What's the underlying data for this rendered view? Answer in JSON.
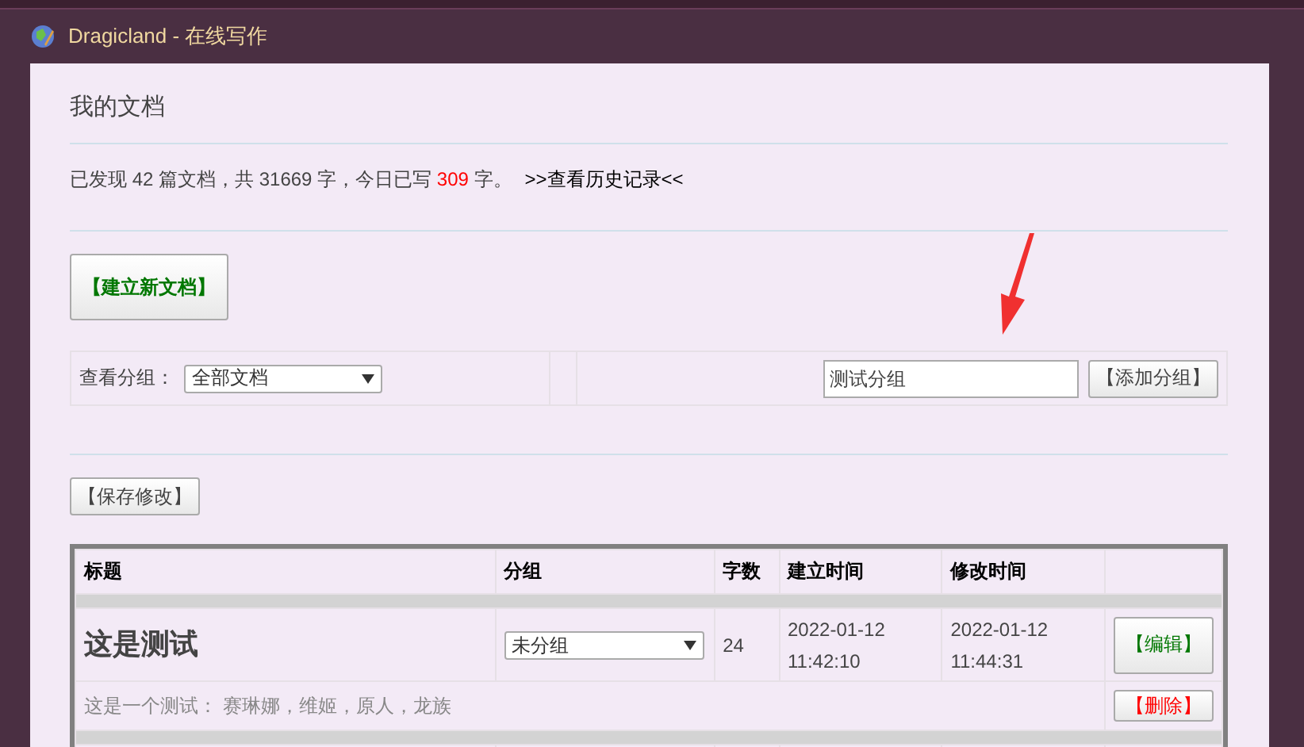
{
  "window": {
    "title": "Dragicland - 在线写作"
  },
  "heading": "我的文档",
  "stats": {
    "before": "已发现 42 篇文档，共 31669 字，今日已写 ",
    "today": "309",
    "after": " 字。",
    "link": ">>查看历史记录<<"
  },
  "new_button": "【建立新文档】",
  "group_filter": {
    "label": "查看分组：",
    "value": "全部文档"
  },
  "new_group": {
    "value": "测试分组",
    "button": "【添加分组】"
  },
  "save_button": "【保存修改】",
  "table": {
    "columns": [
      "标题",
      "分组",
      "字数",
      "建立时间",
      "修改时间"
    ],
    "rows": [
      {
        "title": "这是测试",
        "group": "未分组",
        "words": "24",
        "created": [
          "2022-01-12",
          "11:42:10"
        ],
        "modified": [
          "2022-01-12",
          "11:44:31"
        ],
        "summary": "这是一个测试： 赛琳娜，维姬，原人，龙族",
        "edit": "【编辑】",
        "delete": "【删除】"
      }
    ]
  }
}
